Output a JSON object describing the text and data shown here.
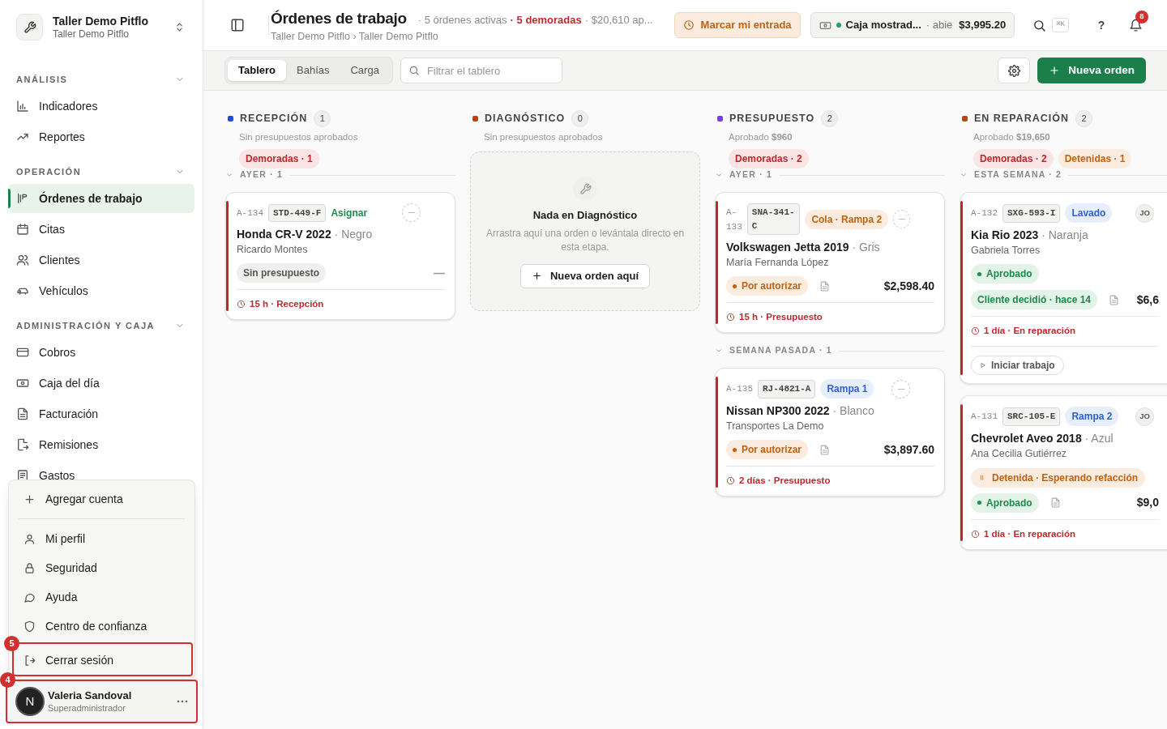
{
  "sidebar": {
    "workspace": {
      "name": "Taller Demo Pitflo",
      "subtitle": "Taller Demo Pitflo"
    },
    "sections": [
      {
        "title": "ANÁLISIS",
        "expanded": true,
        "items": [
          {
            "label": "Indicadores",
            "selected": false
          },
          {
            "label": "Reportes",
            "selected": false
          }
        ]
      },
      {
        "title": "OPERACIÓN",
        "expanded": true,
        "items": [
          {
            "label": "Órdenes de trabajo",
            "selected": true
          },
          {
            "label": "Citas",
            "selected": false
          },
          {
            "label": "Clientes",
            "selected": false
          },
          {
            "label": "Vehículos",
            "selected": false
          }
        ]
      },
      {
        "title": "ADMINISTRACIÓN Y CAJA",
        "expanded": true,
        "items": [
          {
            "label": "Cobros",
            "selected": false
          },
          {
            "label": "Caja del día",
            "selected": false
          },
          {
            "label": "Facturación",
            "selected": false
          },
          {
            "label": "Remisiones",
            "selected": false
          },
          {
            "label": "Gastos",
            "selected": false
          }
        ]
      }
    ],
    "account_menu": [
      {
        "kind": "item",
        "label": "Agregar cuenta"
      },
      {
        "kind": "separator"
      },
      {
        "kind": "item",
        "label": "Mi perfil"
      },
      {
        "kind": "item",
        "label": "Seguridad"
      },
      {
        "kind": "item",
        "label": "Ayuda"
      },
      {
        "kind": "item",
        "label": "Centro de confianza"
      },
      {
        "kind": "item",
        "label": "Cerrar sesión",
        "annotation": "5"
      }
    ],
    "user": {
      "initial": "N",
      "name": "Valeria Sandoval",
      "role": "Superadministrador",
      "annotation": "4"
    }
  },
  "header": {
    "title": "Órdenes de trabajo",
    "breadcrumb": "Taller Demo Pitflo › Taller Demo Pitflo",
    "stats": [
      {
        "text": "· 5 órdenes activas",
        "kind": "muted"
      },
      {
        "text": "· 5 demoradas",
        "kind": "alert"
      },
      {
        "text": "· $20,610 ap...",
        "kind": "muted"
      }
    ],
    "check_in": "Marcar mi entrada",
    "register": {
      "name": "Caja mostrad...",
      "status": "· abie",
      "amount": "$3,995.20"
    },
    "shortcut": "⌘K",
    "help": "?",
    "notifications": "8"
  },
  "toolbar": {
    "tabs": [
      {
        "label": "Tablero",
        "selected": true
      },
      {
        "label": "Bahías",
        "selected": false
      },
      {
        "label": "Carga",
        "selected": false
      }
    ],
    "filter": {
      "placeholder": "Filtrar el tablero"
    },
    "new_order": "Nueva orden"
  },
  "columns": [
    {
      "title": "RECEPCIÓN",
      "color": "#1d4ed8",
      "count": "1",
      "summary": "Sin presupuestos aprobados",
      "tags": [
        {
          "text": "Demoradas · 1",
          "kind": "delayed"
        }
      ],
      "groups": [
        {
          "label": "AYER · 1",
          "expanded": true,
          "cards": [
            {
              "id": "A-134",
              "plate": "STD-449-F",
              "bay": {
                "text": "Asignar",
                "kind": "link"
              },
              "vehicle": "Honda CR-V 2022",
              "vehicle_color": "· Negro",
              "customer": "Ricardo Montes",
              "delayed": true,
              "statuses": [
                {
                  "text": "Sin presupuesto",
                  "kind": "neutral"
                }
              ],
              "has_document": false,
              "amount": "—",
              "footer": "15 h · Recepción"
            }
          ]
        }
      ]
    },
    {
      "title": "DIAGNÓSTICO",
      "color": "#c2410c",
      "count": "0",
      "summary": "Sin presupuestos aprobados",
      "empty": {
        "title": "Nada en Diagnóstico",
        "text": "Arrastra aquí una orden o levántala directo en esta etapa.",
        "button": "Nueva orden aquí"
      }
    },
    {
      "title": "PRESUPUESTO",
      "color": "#7c3aed",
      "count": "2",
      "summary": "Aprobado **$960**",
      "tags": [
        {
          "text": "Demoradas · 2",
          "kind": "delayed"
        }
      ],
      "groups": [
        {
          "label": "AYER · 1",
          "expanded": true,
          "cards": [
            {
              "id": "A-133",
              "plate": "SNA-341-C",
              "bay": {
                "text": "Cola · Rampa 2",
                "kind": "queue"
              },
              "vehicle": "Volkswagen Jetta 2019",
              "vehicle_color": "· Gris",
              "customer": "María Fernanda López",
              "delayed": true,
              "statuses": [
                {
                  "text": "Por autorizar",
                  "kind": "pending",
                  "dot": true
                }
              ],
              "has_document": true,
              "amount": "$2,598.40",
              "footer": "15 h · Presupuesto"
            }
          ]
        },
        {
          "label": "SEMANA PASADA · 1",
          "expanded": true,
          "cards": [
            {
              "id": "A-135",
              "plate": "RJ-4821-A",
              "bay": {
                "text": "Rampa 1",
                "kind": "bay"
              },
              "vehicle": "Nissan NP300 2022",
              "vehicle_color": "· Blanco",
              "customer": "Transportes La Demo",
              "delayed": true,
              "statuses": [
                {
                  "text": "Por autorizar",
                  "kind": "pending",
                  "dot": true
                }
              ],
              "has_document": true,
              "amount": "$3,897.60",
              "footer": "2 días · Presupuesto"
            }
          ]
        }
      ]
    },
    {
      "title": "EN REPARACIÓN",
      "color": "#c2410c",
      "count": "2",
      "summary": "Aprobado **$19,650**",
      "tags": [
        {
          "text": "Demoradas · 2",
          "kind": "delayed"
        },
        {
          "text": "Detenidas · 1",
          "kind": "held"
        }
      ],
      "groups": [
        {
          "label": "ESTA SEMANA · 2",
          "expanded": true,
          "cards": [
            {
              "id": "A-132",
              "plate": "SXG-593-I",
              "bay": {
                "text": "Lavado",
                "kind": "bay"
              },
              "assignee": "JO",
              "vehicle": "Kia Rio 2023",
              "vehicle_color": "· Naranja",
              "customer": "Gabriela Torres",
              "delayed": true,
              "statuses": [
                {
                  "text": "Aprobado",
                  "kind": "approved",
                  "dot": true
                },
                {
                  "text": "Cliente decidió · hace 14",
                  "kind": "approved"
                }
              ],
              "has_document": true,
              "amount": "$6,6",
              "footer": "1 día · En reparación",
              "action": "Iniciar trabajo"
            },
            {
              "id": "A-131",
              "plate": "SRC-105-E",
              "bay": {
                "text": "Rampa 2",
                "kind": "bay"
              },
              "assignee": "JO",
              "vehicle": "Chevrolet Aveo 2018",
              "vehicle_color": "· Azul",
              "customer": "Ana Cecilia Gutiérrez",
              "delayed": true,
              "hold": "Detenida · Esperando refacción",
              "statuses": [
                {
                  "text": "Aprobado",
                  "kind": "approved",
                  "dot": true
                }
              ],
              "has_document": true,
              "amount": "$9,0",
              "footer": "1 día · En reparación"
            }
          ]
        }
      ]
    }
  ]
}
